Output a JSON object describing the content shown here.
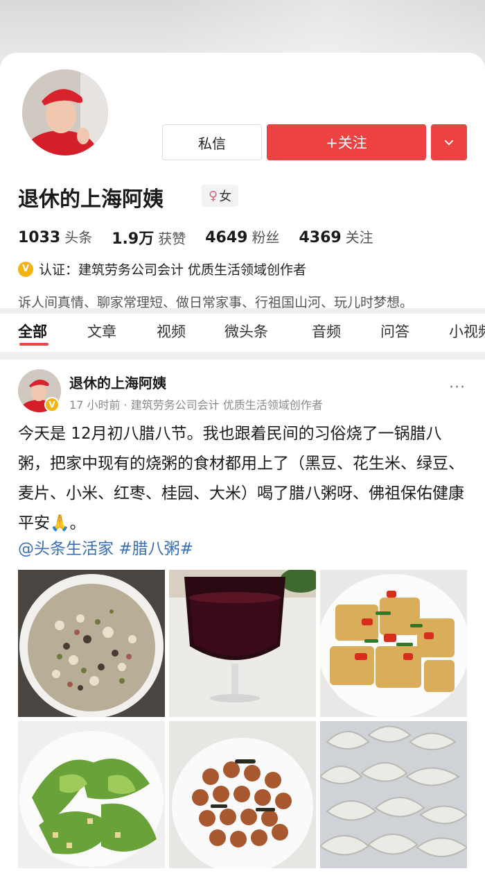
{
  "profile": {
    "name": "退休的上海阿姨",
    "gender": "女",
    "gender_symbol": "♀",
    "stats": [
      {
        "num": "1033",
        "label": "头条"
      },
      {
        "num": "1.9万",
        "label": "获赞"
      },
      {
        "num": "4649",
        "label": "粉丝"
      },
      {
        "num": "4369",
        "label": "关注"
      }
    ],
    "verification_badge": "V",
    "verification": "认证：建筑劳务公司会计 优质生活领域创作者",
    "bio": "诉人间真情、聊家常理短、做日常家事、行祖国山河、玩儿时梦想。"
  },
  "actions": {
    "message_label": "私信",
    "follow_label": "+关注"
  },
  "tabs": [
    {
      "label": "全部",
      "active": true
    },
    {
      "label": "文章"
    },
    {
      "label": "视频"
    },
    {
      "label": "微头条"
    },
    {
      "label": "音频"
    },
    {
      "label": "问答"
    },
    {
      "label": "小视频"
    }
  ],
  "post": {
    "author": "退休的上海阿姨",
    "verification_badge": "V",
    "meta": "17 小时前 · 建筑劳务公司会计 优质生活领域创作者",
    "more_label": "···",
    "text": "今天是 12月初八腊八节。我也跟着民间的习俗烧了一锅腊八粥，把家中现有的烧粥的食材都用上了（黑豆、花生米、绿豆、麦片、小米、红枣、桂园、大米）喝了腊八粥呀、佛祖保佑健康平安🙏。",
    "tags": [
      "@头条生活家",
      "#腊八粥#"
    ],
    "photos": [
      {
        "name": "photo-laba-porridge"
      },
      {
        "name": "photo-red-wine"
      },
      {
        "name": "photo-tofu-with-peppers"
      },
      {
        "name": "photo-lettuce"
      },
      {
        "name": "photo-peanuts"
      },
      {
        "name": "photo-dumplings"
      }
    ]
  },
  "colors": {
    "accent": "#ec4342",
    "link": "#3b6fb5",
    "verify": "#f5b312"
  }
}
